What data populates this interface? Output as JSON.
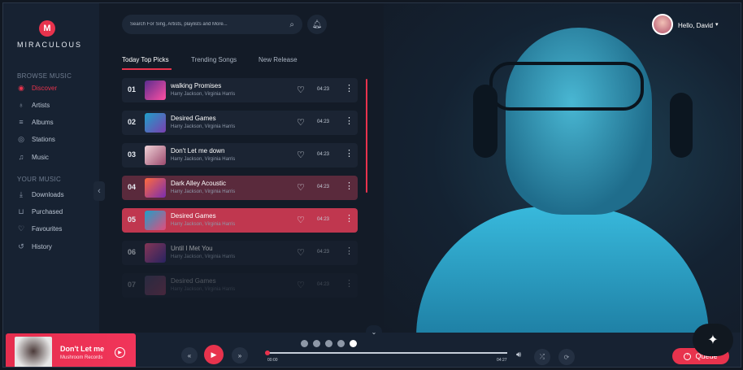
{
  "brand": {
    "badge": "M",
    "name": "MIRACULOUS"
  },
  "sidebar": {
    "browse_title": "BROWSE MUSIC",
    "browse_items": [
      {
        "label": "Discover",
        "icon": "eye-icon",
        "active": true
      },
      {
        "label": "Artists",
        "icon": "microphone-icon"
      },
      {
        "label": "Albums",
        "icon": "album-icon"
      },
      {
        "label": "Stations",
        "icon": "radio-icon"
      },
      {
        "label": "Music",
        "icon": "music-note-icon"
      }
    ],
    "your_title": "YOUR MUSIC",
    "your_items": [
      {
        "label": "Downloads",
        "icon": "download-icon"
      },
      {
        "label": "Purchased",
        "icon": "cart-icon"
      },
      {
        "label": "Favourites",
        "icon": "heart-icon"
      },
      {
        "label": "History",
        "icon": "history-icon"
      }
    ]
  },
  "search": {
    "placeholder": "Search For Sing, Artists, playlists and More..."
  },
  "user": {
    "greeting": "Hello, David"
  },
  "tabs": [
    {
      "label": "Today Top Picks",
      "active": true
    },
    {
      "label": "Trending Songs"
    },
    {
      "label": "New Release"
    }
  ],
  "tracks": [
    {
      "num": "01",
      "title": "walking Promises",
      "artist": "Harry Jackson, Virginia Harris",
      "duration": "04:23"
    },
    {
      "num": "02",
      "title": "Desired Games",
      "artist": "Harry Jackson, Virginia Harris",
      "duration": "04:23"
    },
    {
      "num": "03",
      "title": "Don't Let me down",
      "artist": "Harry Jackson, Virginia Harris",
      "duration": "04:23"
    },
    {
      "num": "04",
      "title": "Dark Alley Acoustic",
      "artist": "Harry Jackson, Virginia Harris",
      "duration": "04:23"
    },
    {
      "num": "05",
      "title": "Desired Games",
      "artist": "Harry Jackson, Virginia Harris",
      "duration": "04:23"
    },
    {
      "num": "06",
      "title": "Until I Met You",
      "artist": "Harry Jackson, Virginia Harris",
      "duration": "04:23"
    },
    {
      "num": "07",
      "title": "Desired Games",
      "artist": "Harry Jackson, Virginia Harris",
      "duration": "04:23"
    }
  ],
  "now_playing": {
    "title": "Don't Let me",
    "label": "Mushroom Records"
  },
  "player": {
    "current_time": "00:00",
    "total_time": "04:27",
    "progress": 0.0,
    "queue_label": "Queue",
    "slide_count": 5,
    "active_slide": 5
  },
  "colors": {
    "accent": "#e8334d",
    "background": "#131b27",
    "sidebar": "#172232"
  }
}
